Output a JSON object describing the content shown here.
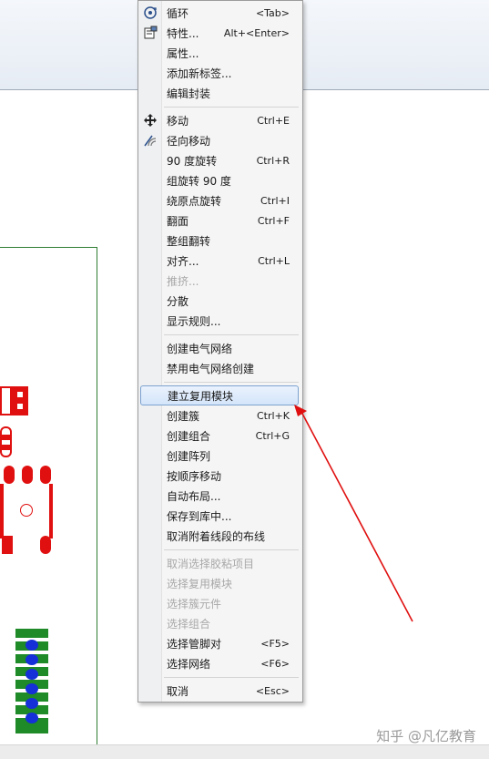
{
  "menu": {
    "items": [
      {
        "label": "循环",
        "shortcut": "<Tab>",
        "state": "normal",
        "icon": "cycle-icon"
      },
      {
        "label": "特性...",
        "shortcut": "Alt+<Enter>",
        "state": "normal",
        "icon": "properties-icon"
      },
      {
        "label": "属性...",
        "shortcut": "",
        "state": "normal"
      },
      {
        "label": "添加新标签...",
        "shortcut": "",
        "state": "normal"
      },
      {
        "label": "编辑封装",
        "shortcut": "",
        "state": "normal"
      },
      {
        "label": "移动",
        "shortcut": "Ctrl+E",
        "state": "normal",
        "icon": "move-icon"
      },
      {
        "label": "径向移动",
        "shortcut": "",
        "state": "normal",
        "icon": "radial-move-icon"
      },
      {
        "label": "90 度旋转",
        "shortcut": "Ctrl+R",
        "state": "normal"
      },
      {
        "label": "组旋转 90 度",
        "shortcut": "",
        "state": "normal"
      },
      {
        "label": "绕原点旋转",
        "shortcut": "Ctrl+I",
        "state": "normal"
      },
      {
        "label": "翻面",
        "shortcut": "Ctrl+F",
        "state": "normal"
      },
      {
        "label": "整组翻转",
        "shortcut": "",
        "state": "normal"
      },
      {
        "label": "对齐...",
        "shortcut": "Ctrl+L",
        "state": "normal"
      },
      {
        "label": "推挤...",
        "shortcut": "",
        "state": "disabled"
      },
      {
        "label": "分散",
        "shortcut": "",
        "state": "normal"
      },
      {
        "label": "显示规则...",
        "shortcut": "",
        "state": "normal"
      },
      {
        "label": "创建电气网络",
        "shortcut": "",
        "state": "normal"
      },
      {
        "label": "禁用电气网络创建",
        "shortcut": "",
        "state": "normal"
      },
      {
        "label": "建立复用模块",
        "shortcut": "",
        "state": "highlight"
      },
      {
        "label": "创建簇",
        "shortcut": "Ctrl+K",
        "state": "normal"
      },
      {
        "label": "创建组合",
        "shortcut": "Ctrl+G",
        "state": "normal"
      },
      {
        "label": "创建阵列",
        "shortcut": "",
        "state": "normal"
      },
      {
        "label": "按顺序移动",
        "shortcut": "",
        "state": "normal"
      },
      {
        "label": "自动布局...",
        "shortcut": "",
        "state": "normal"
      },
      {
        "label": "保存到库中...",
        "shortcut": "",
        "state": "normal"
      },
      {
        "label": "取消附着线段的布线",
        "shortcut": "",
        "state": "normal"
      },
      {
        "label": "取消选择胶粘项目",
        "shortcut": "",
        "state": "disabled"
      },
      {
        "label": "选择复用模块",
        "shortcut": "",
        "state": "disabled"
      },
      {
        "label": "选择簇元件",
        "shortcut": "",
        "state": "disabled"
      },
      {
        "label": "选择组合",
        "shortcut": "",
        "state": "disabled"
      },
      {
        "label": "选择管脚对",
        "shortcut": "<F5>",
        "state": "normal"
      },
      {
        "label": "选择网络",
        "shortcut": "<F6>",
        "state": "normal"
      },
      {
        "label": "取消",
        "shortcut": "<Esc>",
        "state": "normal"
      }
    ]
  },
  "watermark": "知乎 @凡亿教育",
  "colors": {
    "annotation_arrow": "#e01010",
    "pad_red": "#e01010",
    "board_outline": "#2e7d32",
    "via_blue": "#1530d8",
    "menu_highlight_border": "#7da2ce"
  }
}
